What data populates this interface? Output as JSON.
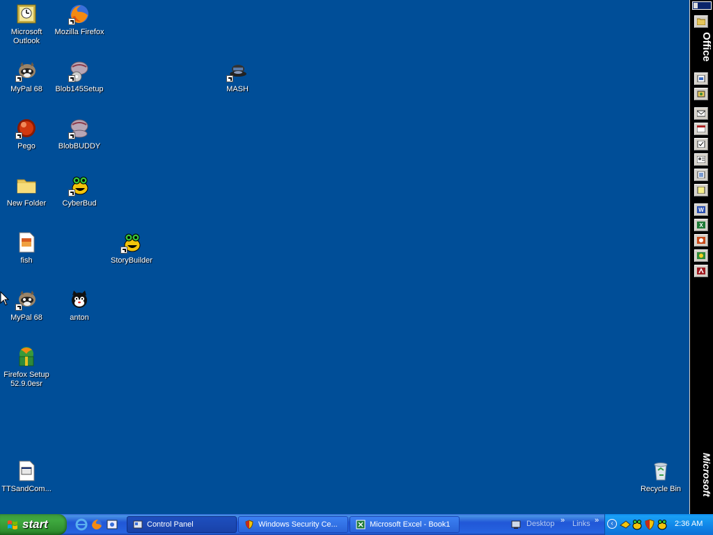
{
  "desktop": {
    "icons": [
      {
        "label": "Microsoft Outlook",
        "icon": "outlook-icon",
        "shortcut": false
      },
      {
        "label": "Mozilla Firefox",
        "icon": "firefox-icon",
        "shortcut": true
      },
      {
        "label": "MyPal 68",
        "icon": "raccoon-icon",
        "shortcut": true
      },
      {
        "label": "Blob145Setup",
        "icon": "blob-setup-icon",
        "shortcut": true
      },
      {
        "label": "MASH",
        "icon": "mash-icon",
        "shortcut": true
      },
      {
        "label": "Pego",
        "icon": "pego-icon",
        "shortcut": true
      },
      {
        "label": "BlobBUDDY",
        "icon": "blobbuddy-icon",
        "shortcut": true
      },
      {
        "label": "New Folder",
        "icon": "folder-icon",
        "shortcut": false
      },
      {
        "label": "CyberBud",
        "icon": "cyberbud-icon",
        "shortcut": true
      },
      {
        "label": "fish",
        "icon": "image-file-icon",
        "shortcut": false
      },
      {
        "label": "StoryBuilder",
        "icon": "storybuilder-icon",
        "shortcut": true
      },
      {
        "label": "MyPal 68",
        "icon": "raccoon-icon",
        "shortcut": true
      },
      {
        "label": "anton",
        "icon": "cat-icon",
        "shortcut": false
      },
      {
        "label": "Firefox Setup 52.9.0esr",
        "icon": "firefox-setup-icon",
        "shortcut": false
      },
      {
        "label": "TTSandCom...",
        "icon": "exe-file-icon",
        "shortcut": false
      },
      {
        "label": "Recycle Bin",
        "icon": "recycle-bin-icon",
        "shortcut": false
      }
    ]
  },
  "office_bar": {
    "top_label": "Office",
    "bottom_label": "Microsoft",
    "buttons": [
      "folder-icon",
      "office-doc-icon",
      "office-open-icon",
      "mail-icon",
      "calendar-icon",
      "task-icon",
      "contact-icon",
      "journal-icon",
      "note-icon",
      "word-icon",
      "excel-icon",
      "powerpoint-icon",
      "publisher-icon",
      "access-icon"
    ]
  },
  "taskbar": {
    "start_label": "start",
    "quick_launch": [
      "ie-icon",
      "firefox-icon",
      "outlook-express-icon"
    ],
    "tasks": [
      {
        "label": "Control Panel",
        "icon": "control-panel-icon",
        "active": true
      },
      {
        "label": "Windows Security Ce...",
        "icon": "shield-icon",
        "active": false
      },
      {
        "label": "Microsoft Excel - Book1",
        "icon": "excel-icon",
        "active": false
      }
    ],
    "toolbars": {
      "desktop": "Desktop",
      "links": "Links"
    },
    "tray_icons": [
      "bonzi-icon",
      "cyberbud-tray-icon",
      "shield-tray-icon",
      "buddy-tray-icon"
    ],
    "clock": "2:36 AM"
  },
  "colors": {
    "desktop_bg": "#004e98",
    "taskbar": "#2157d7",
    "start_green": "#3fa93f",
    "tray": "#0f84e7"
  }
}
